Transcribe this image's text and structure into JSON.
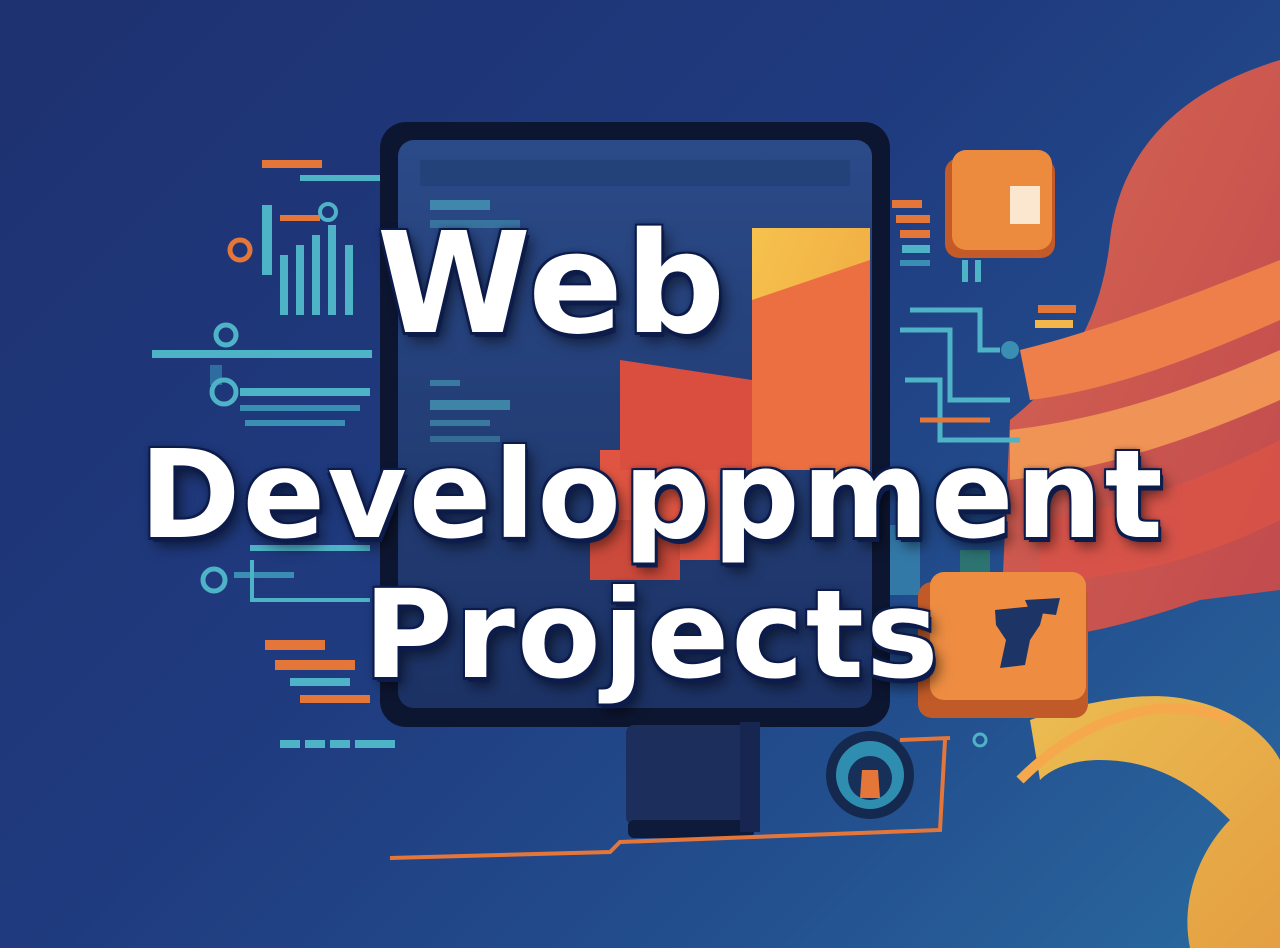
{
  "poster": {
    "line1": "Web",
    "line2": "Developpment",
    "line3": "Projects"
  },
  "colors": {
    "background_dark": "#1e3170",
    "background_light": "#2a6aa0",
    "accent_orange": "#e77c3a",
    "accent_red": "#d95a45",
    "accent_yellow": "#f2b64a",
    "accent_teal": "#4fb3c7",
    "monitor_frame": "#101a35",
    "text": "#ffffff"
  },
  "icons": [
    "monitor-illustration",
    "orange-cube-icon",
    "orange-box-icon",
    "dial-knob-icon",
    "wave-shape"
  ]
}
